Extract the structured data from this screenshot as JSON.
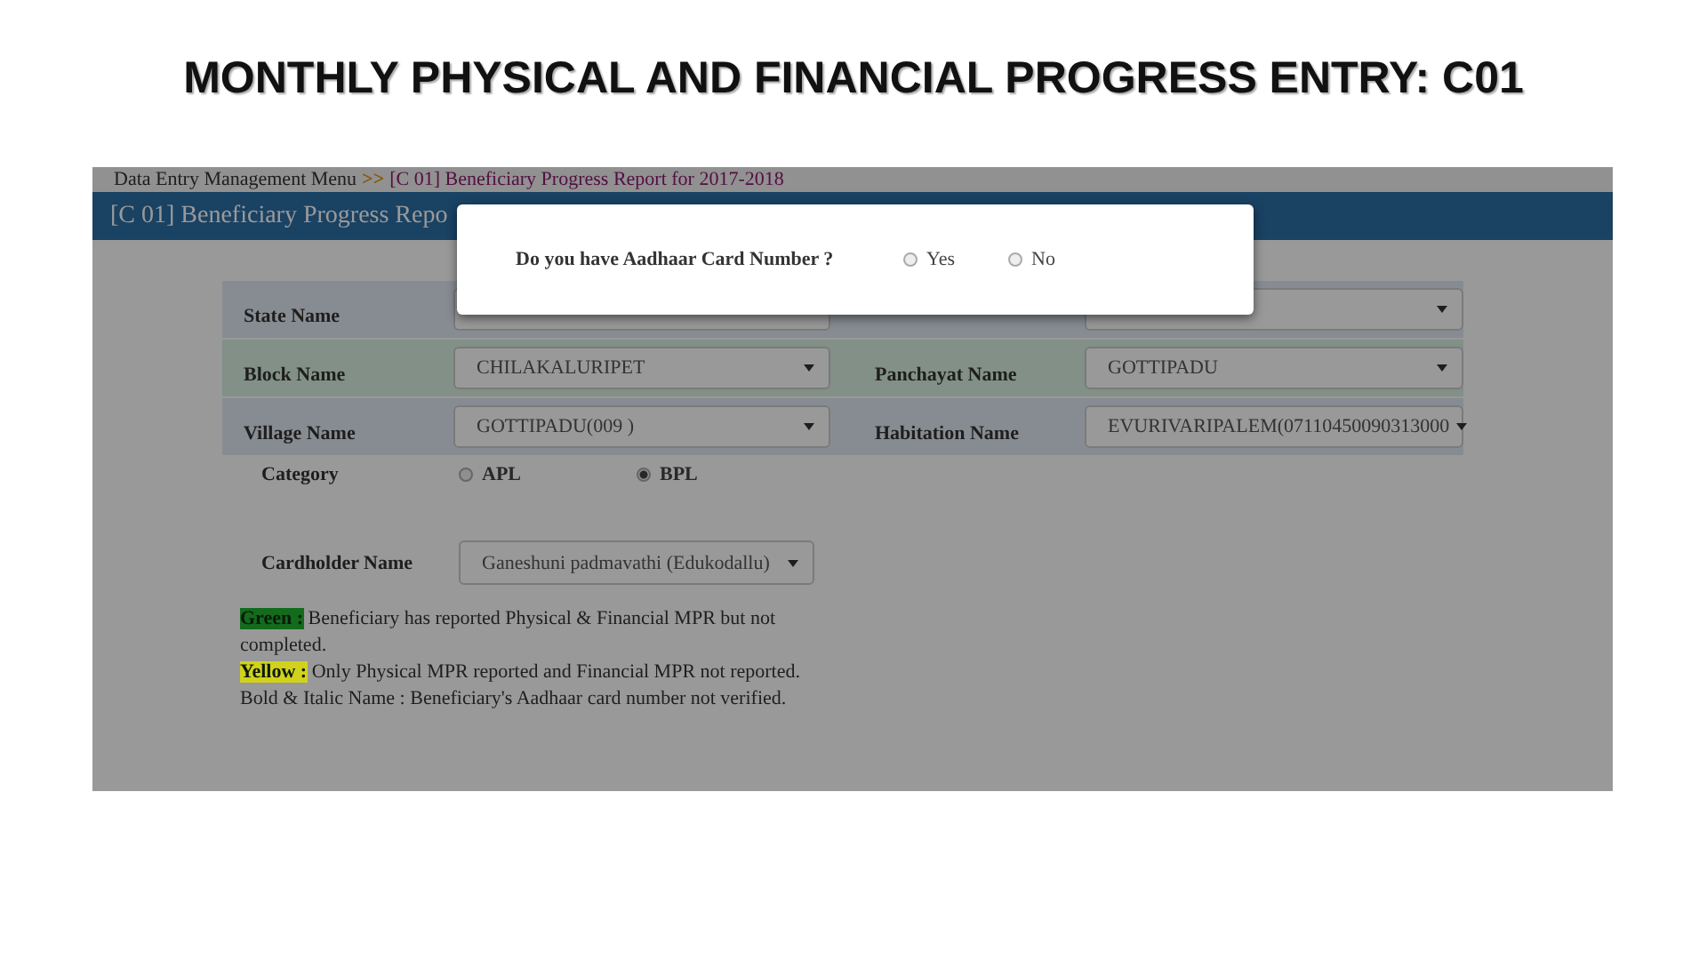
{
  "slide_title": "MONTHLY PHYSICAL AND FINANCIAL PROGRESS ENTRY: C01",
  "breadcrumb": {
    "menu": "Data Entry Management Menu",
    "separator": ">>",
    "current": "[C 01] Beneficiary Progress Report for 2017-2018"
  },
  "page_title": "[C 01] Beneficiary Progress Repo",
  "form_rows": [
    {
      "label": "State Name"
    },
    {
      "label": "Block Name",
      "value": "CHILAKALURIPET",
      "label_2": "Panchayat Name",
      "value_2": "GOTTIPADU"
    },
    {
      "label": "Village Name",
      "value": "GOTTIPADU(009 )",
      "label_2": "Habitation Name",
      "value_2": "EVURIVARIPALEM(07110450090313000"
    }
  ],
  "category": {
    "label": "Category",
    "options": [
      {
        "label": "APL",
        "selected": false
      },
      {
        "label": "BPL",
        "selected": true
      }
    ]
  },
  "cardholder": {
    "label": "Cardholder Name",
    "value": "Ganeshuni padmavathi (Edukodallu)"
  },
  "legend": [
    {
      "key": "Green :",
      "color": "#136b1c",
      "text": "Beneficiary has reported Physical & Financial MPR but not completed."
    },
    {
      "key": "Yellow :",
      "color": "#d2d21c",
      "text": "Only Physical MPR reported and Financial MPR not reported."
    },
    {
      "key": "Bold & Italic Name :",
      "text": "Beneficiary's Aadhaar card number not verified."
    }
  ],
  "modal": {
    "question": "Do you have Aadhaar Card Number ?",
    "options": [
      {
        "label": "Yes",
        "selected": false
      },
      {
        "label": "No",
        "selected": false
      }
    ]
  }
}
